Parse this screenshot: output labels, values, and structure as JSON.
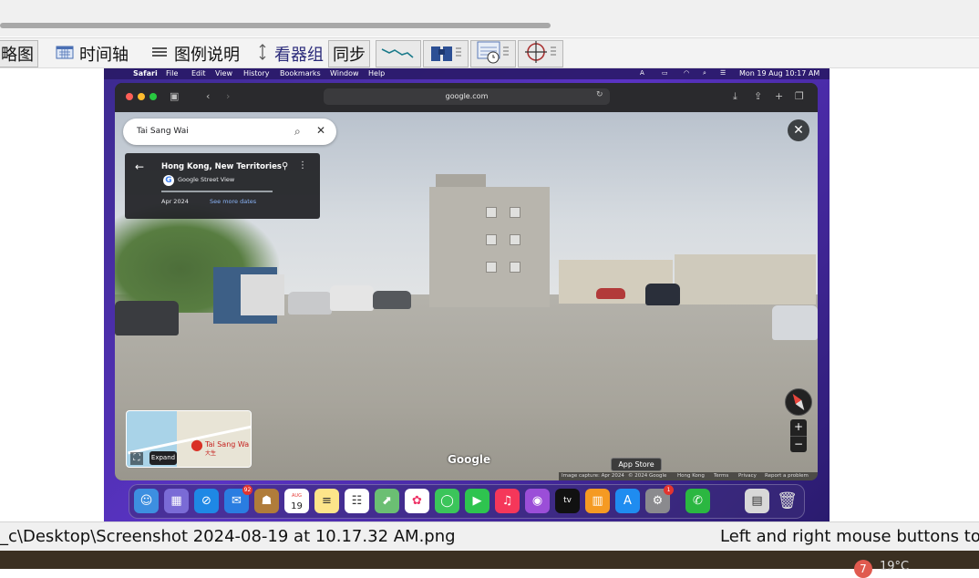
{
  "viewer": {
    "toolbar": {
      "thumbnail_label": "略图",
      "timeline_label": "时间轴",
      "legend_label": "图例说明",
      "watch_label": "看器组",
      "sync_label": "同步"
    },
    "status": {
      "path": "_c\\Desktop\\Screenshot 2024-08-19 at 10.17.32 AM.png",
      "hint": "Left and right mouse buttons to r"
    },
    "taskbar": {
      "badge": "7",
      "temp": "19°C"
    }
  },
  "mac": {
    "menubar": {
      "apple": "",
      "app": "Safari",
      "items": [
        "File",
        "Edit",
        "View",
        "History",
        "Bookmarks",
        "Window",
        "Help"
      ],
      "clock": "Mon 19 Aug  10:17 AM"
    },
    "safari": {
      "address": "google.com"
    },
    "streetview": {
      "search_text": "Tai Sang Wai",
      "info": {
        "title": "Hong Kong, New Territories",
        "source": "Google Street View",
        "date": "Apr 2024",
        "more_dates": "See more dates"
      },
      "minimap": {
        "place": "Tai Sang Wa",
        "place_cn": "大生",
        "expand": "Expand"
      },
      "google": "Google",
      "footer": {
        "capture": "Image capture: Apr 2024",
        "copyright": "© 2024 Google",
        "region": "Hong Kong",
        "terms": "Terms",
        "privacy": "Privacy",
        "report": "Report a problem"
      },
      "zoom_in": "+",
      "zoom_out": "−"
    },
    "tooltip": "App Store",
    "dock": {
      "mail_badge": "92",
      "calendar_month": "AUG",
      "calendar_day": "19",
      "settings_badge": "1"
    }
  },
  "colors": {
    "accent": "#5a33c4",
    "pin": "#d93025",
    "link": "#8ab4f8"
  }
}
